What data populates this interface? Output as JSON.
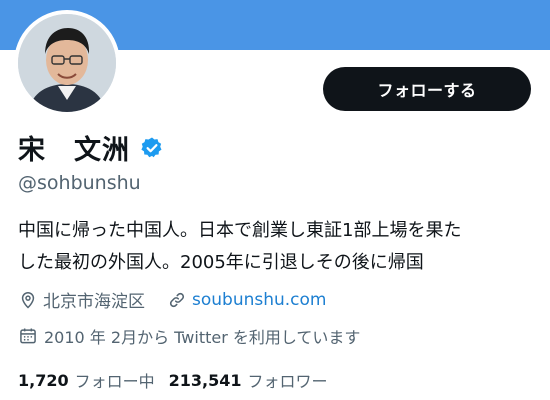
{
  "profile": {
    "display_name": "宋　文洲",
    "handle": "@sohbunshu",
    "verified_icon": "verified-badge-icon",
    "bio_line1": "中国に帰った中国人。日本で創業し東証1部上場を果た",
    "bio_line2": "した最初の外国人。2005年に引退しその後に帰国",
    "location": "北京市海淀区",
    "website": "soubunshu.com",
    "joined": "2010 年 2月から Twitter を利用しています"
  },
  "actions": {
    "follow_label": "フォローする"
  },
  "stats": {
    "following_count": "1,720",
    "following_label": "フォロー中",
    "followers_count": "213,541",
    "followers_label": "フォロワー"
  },
  "colors": {
    "banner": "#4a95e6",
    "button_bg": "#0f1419",
    "link": "#1d7fd1",
    "verified": "#1d9bf0",
    "secondary_text": "#536471"
  }
}
